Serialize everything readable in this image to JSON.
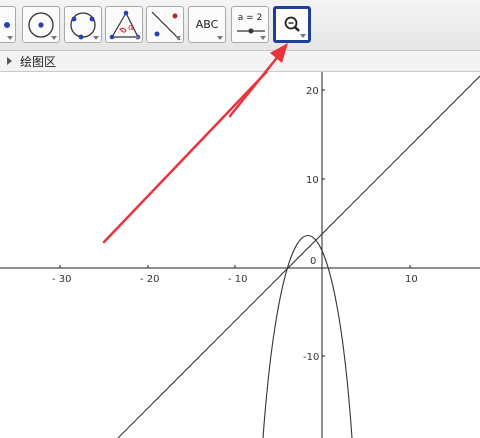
{
  "toolbar": {
    "tools": [
      {
        "name": "point-tool"
      },
      {
        "name": "circle-center-point-tool"
      },
      {
        "name": "circle-three-points-tool"
      },
      {
        "name": "angle-tool"
      },
      {
        "name": "reflect-line-tool"
      },
      {
        "name": "text-tool",
        "label": "ABC"
      },
      {
        "name": "slider-tool",
        "label": "a = 2"
      },
      {
        "name": "zoom-in-tool",
        "active": true
      }
    ]
  },
  "panel": {
    "title": "绘图区"
  },
  "graphics": {
    "x_ticks": [
      "30",
      "20",
      "10",
      "10"
    ],
    "y_ticks": [
      "20",
      "10",
      "10"
    ],
    "origin_label": "0",
    "curves": [
      "parabola",
      "line"
    ],
    "colors": {
      "axes": "#222222",
      "curve": "#333333",
      "arrow": "#e8343a",
      "active_border": "#1f3f9a"
    }
  }
}
